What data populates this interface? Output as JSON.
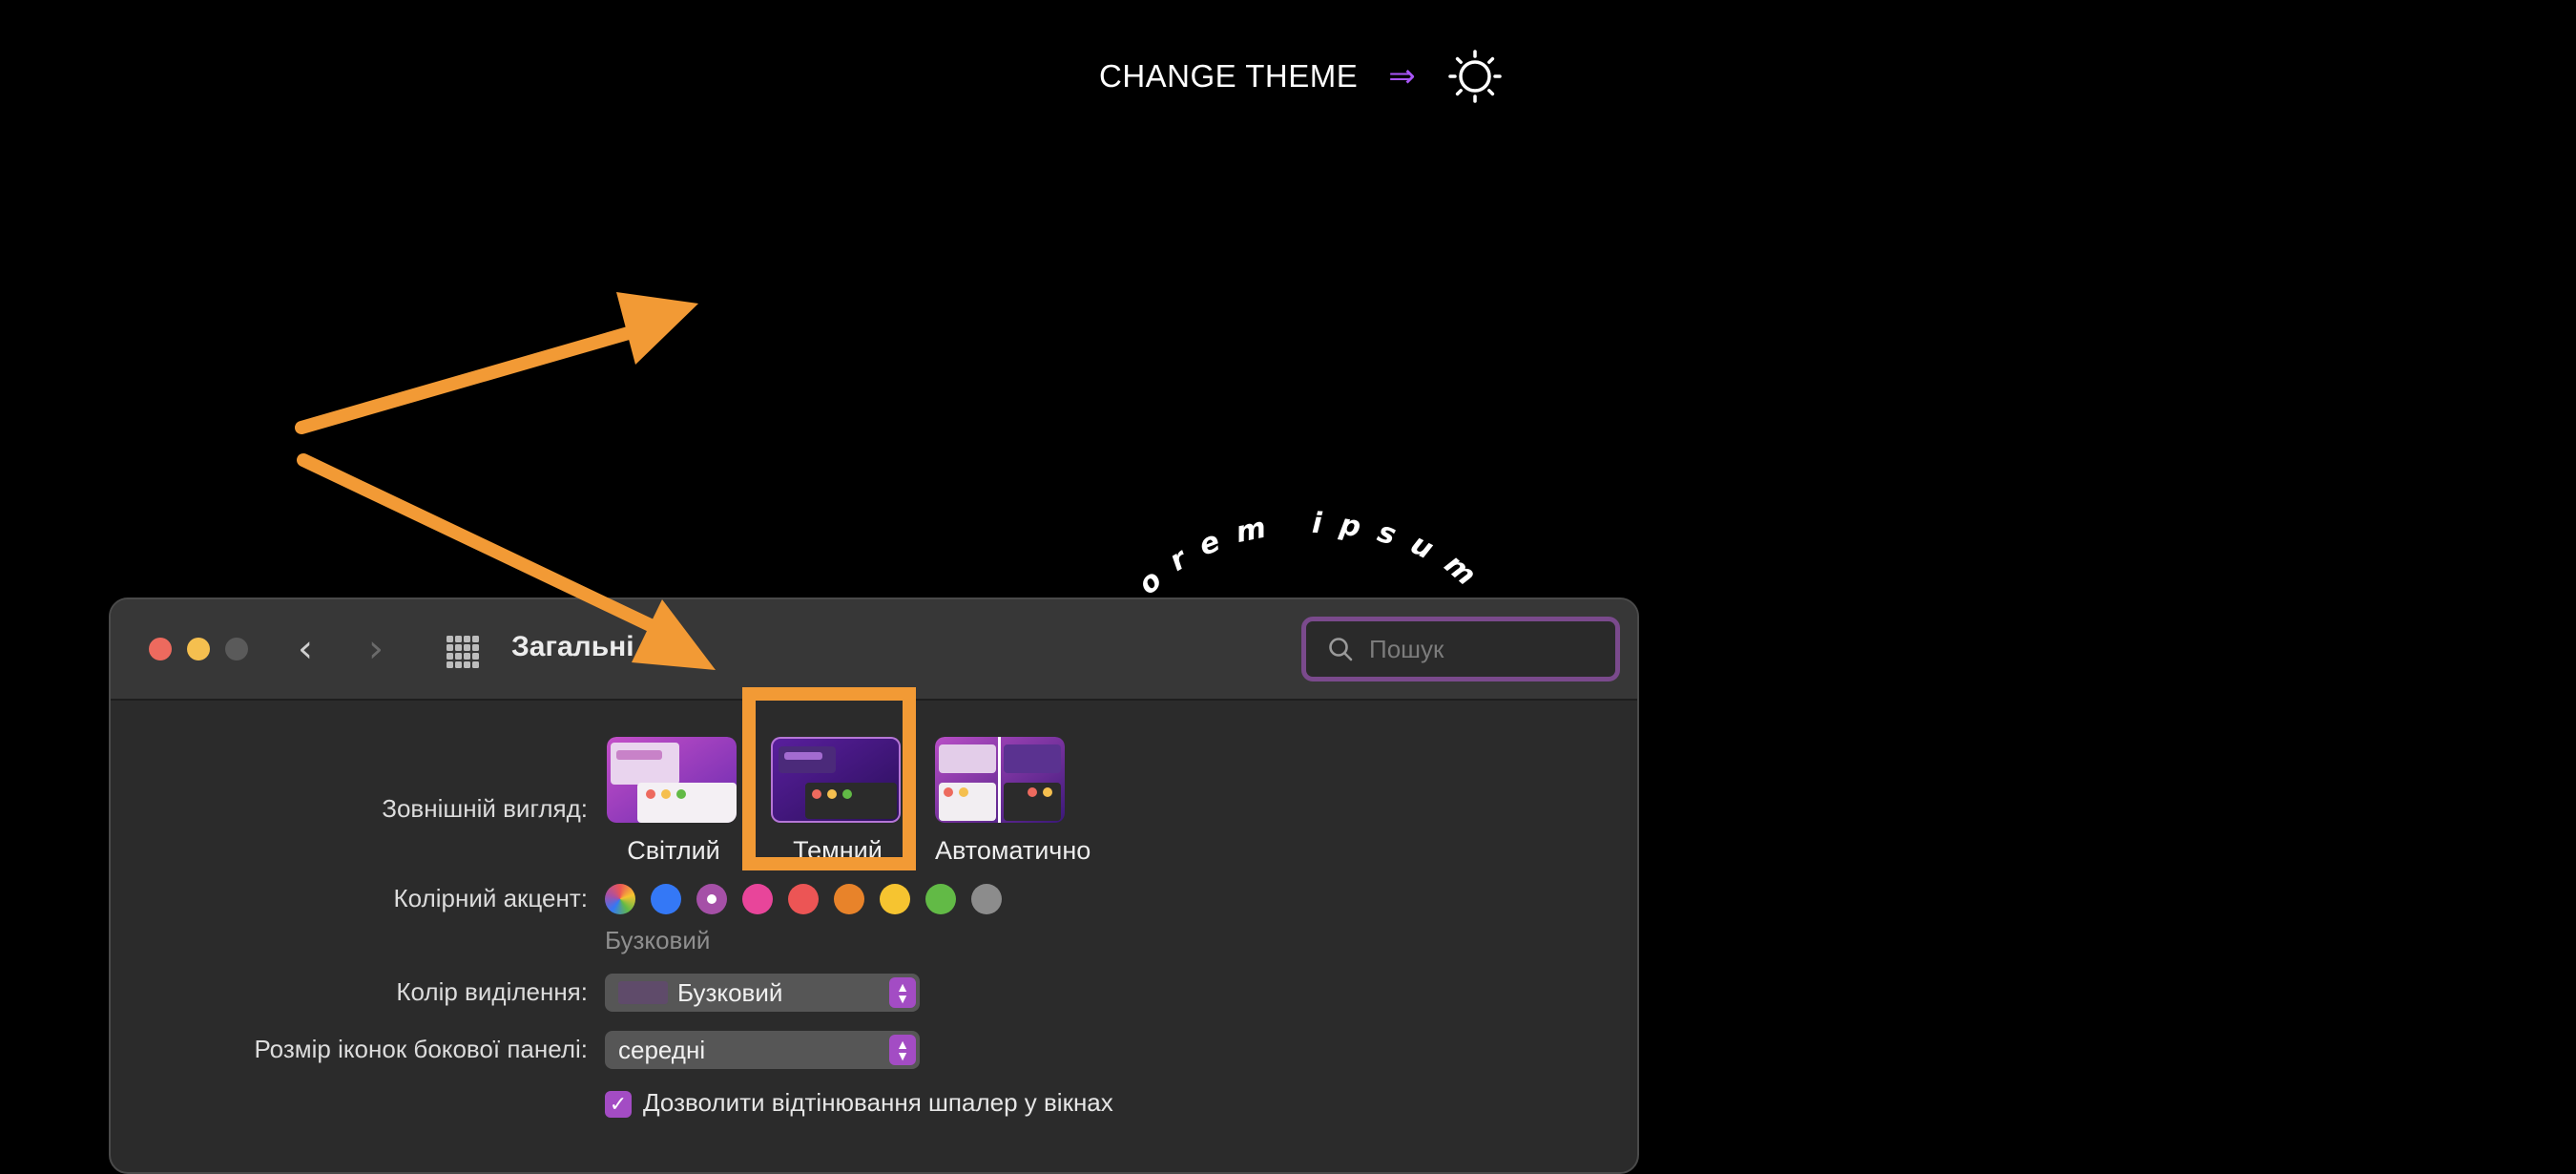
{
  "theme_bar": {
    "label": "CHANGE THEME",
    "arrow": "⇒",
    "icon": "sun-icon"
  },
  "decor": {
    "curved_text": "orem ipsum"
  },
  "window": {
    "title": "Загальні",
    "search_placeholder": "Пошук",
    "appearance": {
      "label": "Зовнішній вигляд:",
      "options": [
        "Світлий",
        "Темний",
        "Автоматично"
      ],
      "selected": "Темний"
    },
    "accent": {
      "label": "Колірний акцент:",
      "colors": [
        "multicolor",
        "#3478f6",
        "#a550a7",
        "#e8459a",
        "#ec5555",
        "#e8832a",
        "#f6c430",
        "#62ba46",
        "#8c8c8c"
      ],
      "selected_name": "Бузковий"
    },
    "highlight": {
      "label": "Колір виділення:",
      "value": "Бузковий"
    },
    "sidebar_size": {
      "label": "Розмір іконок бокової панелі:",
      "value": "середні"
    },
    "tinting": {
      "label": "Дозволити відтінювання шпалер у вікнах",
      "checked": true
    }
  },
  "colors": {
    "annotation": "#f29a35",
    "accent_purple": "#a34cc4"
  }
}
